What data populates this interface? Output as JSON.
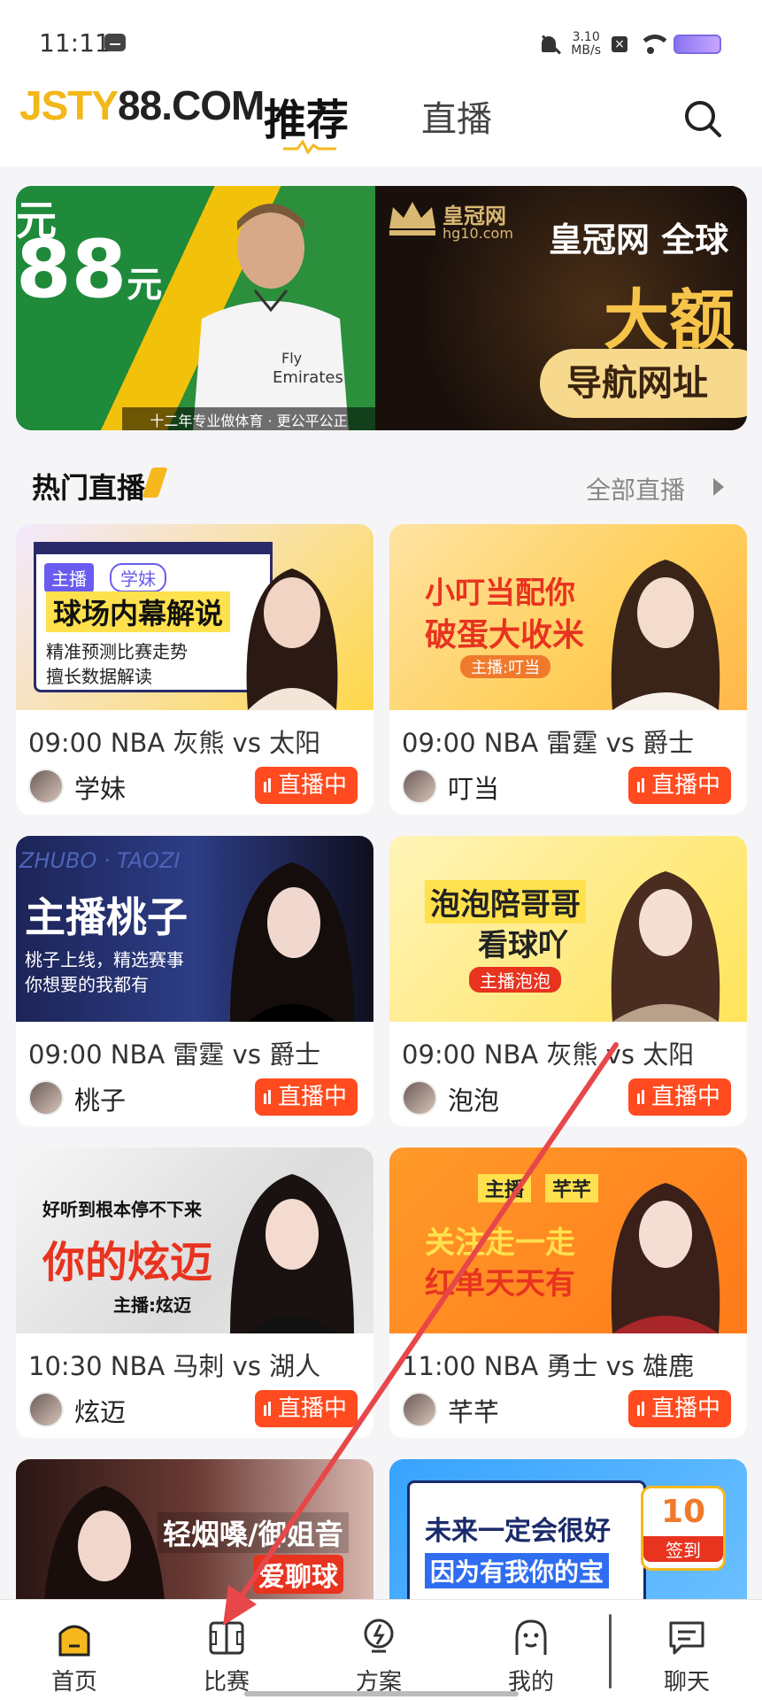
{
  "status_bar": {
    "time": "11:11",
    "speed_value": "3.10",
    "speed_unit": "MB/s"
  },
  "header": {
    "logo_part1": "JSTY",
    "logo_part2": "88.COM",
    "tab_recommend": "推荐",
    "tab_live": "直播"
  },
  "banner": {
    "amount_top": "元",
    "amount": "88",
    "amount_unit": "元",
    "slogan": "十二年专业做体育 · 更公平公正",
    "brand_cn": "皇冠网",
    "brand_url": "hg10.com",
    "headline": "皇冠网 全球",
    "big_text": "大额",
    "button_text": "导航网址"
  },
  "section": {
    "title": "热门直播",
    "more": "全部直播"
  },
  "live_badge_text": "直播中",
  "cards": [
    {
      "cover_title": "球场内幕解说",
      "cover_tags": [
        "主播",
        "学妹"
      ],
      "cover_sub1": "精准预测比赛走势",
      "cover_sub2": "擅长数据解读",
      "match": "09:00 NBA 灰熊 vs 太阳",
      "host": "学妹"
    },
    {
      "cover_title": "小叮当配你",
      "cover_title2": "破蛋大收米",
      "cover_sub1": "主播:叮当",
      "match": "09:00 NBA 雷霆 vs 爵士",
      "host": "叮当"
    },
    {
      "cover_title": "主播桃子",
      "cover_sub1": "桃子上线，精选赛事",
      "cover_sub2": "你想要的我都有",
      "watermark": "ZHUBO · TAOZI",
      "match": "09:00 NBA 雷霆 vs 爵士",
      "host": "桃子"
    },
    {
      "cover_title": "泡泡陪哥哥",
      "cover_title2": "看球吖",
      "cover_sub1": "主播泡泡",
      "match": "09:00 NBA 灰熊 vs 太阳",
      "host": "泡泡"
    },
    {
      "cover_title": "你的炫迈",
      "cover_sub1": "好听到根本停不下来",
      "cover_sub2": "主播:炫迈",
      "match": "10:30 NBA 马刺 vs 湖人",
      "host": "炫迈"
    },
    {
      "cover_title": "关注走一走",
      "cover_title2": "红单天天有",
      "cover_tags": [
        "主播",
        "芊芊"
      ],
      "match": "11:00 NBA 勇士 vs 雄鹿",
      "host": "芊芊"
    },
    {
      "cover_title": "轻烟嗓/御姐音",
      "cover_sub1": "爱聊球"
    },
    {
      "cover_title": "未来一定会很好",
      "cover_sub1": "因为有我你的宝",
      "signin_num": "10",
      "signin_label": "签到"
    }
  ],
  "bottom_nav": [
    {
      "label": "首页",
      "icon": "home-icon",
      "active": true
    },
    {
      "label": "比赛",
      "icon": "match-icon"
    },
    {
      "label": "方案",
      "icon": "plan-icon"
    },
    {
      "label": "我的",
      "icon": "profile-icon"
    },
    {
      "label": "聊天",
      "icon": "chat-icon"
    }
  ],
  "colors": {
    "accent_yellow": "#f6b81d",
    "live_red": "#ff4b1f",
    "annotation_arrow": "#e8474a"
  }
}
